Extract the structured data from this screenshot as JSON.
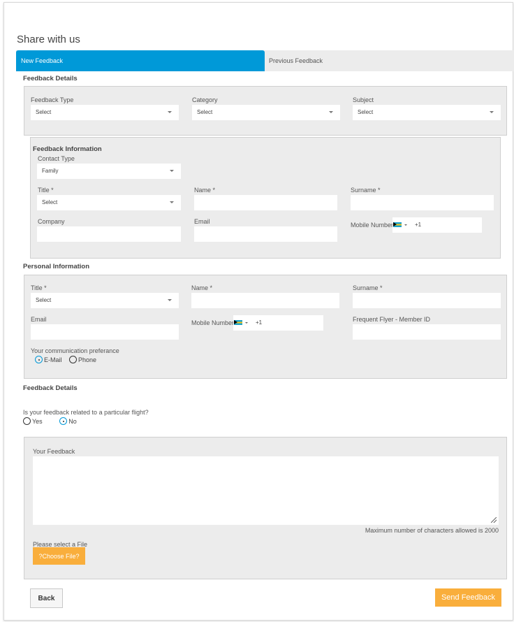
{
  "header": {
    "title": "Share with us"
  },
  "tabs": [
    {
      "label": "New Feedback",
      "active": true
    },
    {
      "label": "Previous Feedback",
      "active": false
    }
  ],
  "feedback_details": {
    "title": "Feedback Details",
    "fields": [
      {
        "label": "Feedback Type",
        "value": "Select"
      },
      {
        "label": "Category",
        "value": "Select"
      },
      {
        "label": "Subject",
        "value": "Select"
      }
    ]
  },
  "feedback_information": {
    "title": "Feedback Information",
    "contact_type": {
      "label": "Contact Type",
      "value": "Family"
    },
    "title_field": {
      "label": "Title *",
      "value": "Select"
    },
    "name": {
      "label": "Name *",
      "value": ""
    },
    "surname": {
      "label": "Surname *",
      "value": ""
    },
    "company": {
      "label": "Company",
      "value": ""
    },
    "email": {
      "label": "Email",
      "value": ""
    },
    "mobile": {
      "label": "Mobile Number",
      "country": "bahamas-flag",
      "dial_code": "+1"
    }
  },
  "personal_information": {
    "title": "Personal Information",
    "title_field": {
      "label": "Title *",
      "value": "Select"
    },
    "name": {
      "label": "Name *",
      "value": ""
    },
    "surname": {
      "label": "Surname *",
      "value": ""
    },
    "email": {
      "label": "Email",
      "value": ""
    },
    "mobile": {
      "label": "Mobile Number",
      "country": "bahamas-flag",
      "dial_code": "+1"
    },
    "frequent_flyer": {
      "label": "Frequent Flyer - Member ID",
      "value": ""
    },
    "communication_preference": {
      "label": "Your communication preferance",
      "options": [
        {
          "label": "E-Mail",
          "selected": true
        },
        {
          "label": "Phone",
          "selected": false
        }
      ]
    }
  },
  "feedback_details_2": {
    "title": "Feedback Details",
    "flight_question": "Is your feedback related to a particular flight?",
    "options": [
      {
        "label": "Yes",
        "selected": false
      },
      {
        "label": "No",
        "selected": true
      }
    ],
    "your_feedback_label": "Your Feedback",
    "your_feedback_value": "",
    "max_chars_note": "Maximum number of characters allowed is 2000",
    "file_label": "Please select a File",
    "choose_file_label": "?Choose File?"
  },
  "actions": {
    "back_label": "Back",
    "send_label": "Send Feedback"
  },
  "colors": {
    "accent_blue": "#0099d8",
    "accent_orange": "#f9ae3c",
    "panel_gray": "#ececec"
  }
}
